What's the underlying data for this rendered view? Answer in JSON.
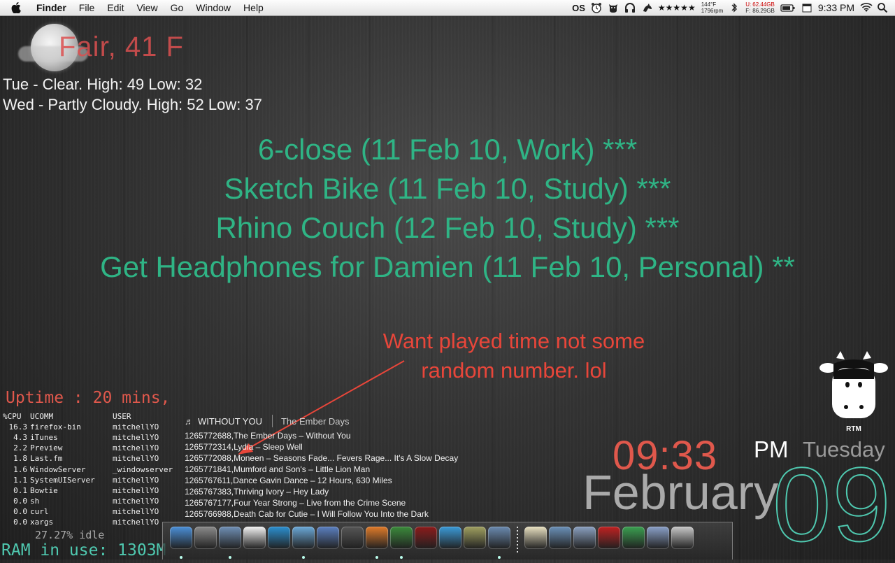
{
  "menubar": {
    "app": "Finder",
    "items": [
      "File",
      "Edit",
      "View",
      "Go",
      "Window",
      "Help"
    ],
    "status_os": "OS",
    "stars": "★★★★★",
    "temp": "144°F",
    "rpm": "1796rpm",
    "disk_u": "U:",
    "disk_f": "F:",
    "disk_used": "62.44GB",
    "disk_free": "86.29GB",
    "clock": "9:33 PM"
  },
  "weather": {
    "current": "Fair, 41 F",
    "forecast": [
      "Tue - Clear. High: 49 Low: 32",
      "Wed - Partly Cloudy. High: 52 Low: 37"
    ]
  },
  "tasks": [
    "6-close (11 Feb 10, Work) ***",
    "Sketch Bike (11 Feb 10, Study) ***",
    "Rhino Couch (12 Feb 10, Study) ***",
    "Get Headphones for Damien (11 Feb 10, Personal) **"
  ],
  "annotation": [
    "Want played time not some",
    "random number. lol"
  ],
  "rtm": {
    "label": "RTM"
  },
  "system": {
    "uptime": "Uptime : 20 mins,",
    "headers": [
      "%CPU",
      "UCOMM",
      "USER"
    ],
    "processes": [
      [
        "16.3",
        "firefox-bin",
        "mitchellYO"
      ],
      [
        "4.3",
        "iTunes",
        "mitchellYO"
      ],
      [
        "2.2",
        "Preview",
        "mitchellYO"
      ],
      [
        "1.8",
        "Last.fm",
        "mitchellYO"
      ],
      [
        "1.6",
        "WindowServer",
        "_windowserver"
      ],
      [
        "1.1",
        "SystemUIServer",
        "mitchellYO"
      ],
      [
        "0.1",
        "Bowtie",
        "mitchellYO"
      ],
      [
        "0.0",
        "sh",
        "mitchellYO"
      ],
      [
        "0.0",
        "curl",
        "mitchellYO"
      ],
      [
        "0.0",
        "xargs",
        "mitchellYO"
      ]
    ],
    "idle": "27.27% idle",
    "ram": "RAM in use: 1303M"
  },
  "now_playing": {
    "track": "WITHOUT YOU",
    "artist": "The Ember Days",
    "recent": [
      "1265772688,The Ember Days – Without You",
      "1265772314,Lydia – Sleep Well",
      "1265772088,Moneen – Seasons Fade... Fevers Rage... It's A Slow Decay",
      "1265771841,Mumford and Son's – Little Lion Man",
      "1265767611,Dance Gavin Dance – 12 Hours, 630 Miles",
      "1265767383,Thriving Ivory – Hey Lady",
      "1265767177,Four Year Strong – Live from the Crime Scene",
      "1265766988,Death Cab for Cutie – I Will Follow You Into the Dark"
    ]
  },
  "clock": {
    "time": "09:33",
    "ampm": "PM",
    "day": "Tuesday",
    "month": "February",
    "date": "09"
  },
  "dock": {
    "icons": [
      {
        "name": "finder-icon",
        "color": "#4a8fd8",
        "running": true
      },
      {
        "name": "system-preferences-icon",
        "color": "#8a8a8a",
        "running": false
      },
      {
        "name": "mail-icon",
        "color": "#6f8fb5",
        "running": true
      },
      {
        "name": "ical-icon",
        "color": "#f2f2f2",
        "running": false
      },
      {
        "name": "wunderlist-icon",
        "color": "#2a8fd0",
        "running": false
      },
      {
        "name": "preview-icon",
        "color": "#6aa8d8",
        "running": true
      },
      {
        "name": "xcode-icon",
        "color": "#5a7fc0",
        "running": false
      },
      {
        "name": "camera-icon",
        "color": "#555",
        "running": false
      },
      {
        "name": "firefox-icon",
        "color": "#e07a28",
        "running": true
      },
      {
        "name": "itunes-icon",
        "color": "#3a8a3a",
        "running": true
      },
      {
        "name": "diablo-icon",
        "color": "#8b1a1a",
        "running": false
      },
      {
        "name": "safari-icon",
        "color": "#3a9ad8",
        "running": false
      },
      {
        "name": "growl-icon",
        "color": "#a0a060",
        "running": false
      },
      {
        "name": "iphoto-icon",
        "color": "#6a8ab0",
        "running": true
      },
      {
        "name": "documents-icon",
        "color": "#e8e0c0",
        "running": false
      },
      {
        "name": "downloads-stack-icon",
        "color": "#6a90b8",
        "running": false
      },
      {
        "name": "applications-folder-icon",
        "color": "#8aa0c0",
        "running": false
      },
      {
        "name": "x-app-icon",
        "color": "#c02020",
        "running": false
      },
      {
        "name": "download-icon",
        "color": "#3aa050",
        "running": false
      },
      {
        "name": "preview-stack-icon",
        "color": "#8aa0c8",
        "running": false
      },
      {
        "name": "trash-icon",
        "color": "#c8c8c8",
        "running": false
      }
    ]
  }
}
